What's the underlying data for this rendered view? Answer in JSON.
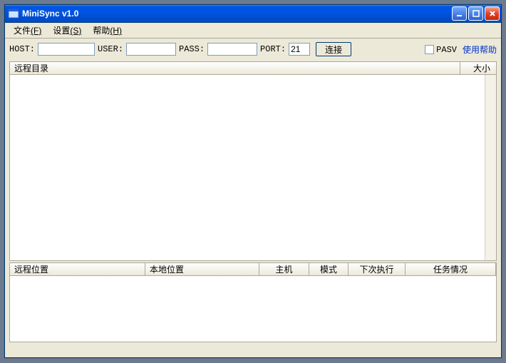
{
  "window": {
    "title": "MiniSync v1.0"
  },
  "menu": {
    "file": "文件",
    "file_accel": "(F)",
    "settings": "设置",
    "settings_accel": "(S)",
    "help": "帮助",
    "help_accel": "(H)"
  },
  "toolbar": {
    "host_label": "HOST:",
    "host_value": "",
    "user_label": "USER:",
    "user_value": "",
    "pass_label": "PASS:",
    "pass_value": "",
    "port_label": "PORT:",
    "port_value": "21",
    "connect_label": "连接",
    "pasv_label": "PASV",
    "pasv_checked": false,
    "help_link": "使用帮助"
  },
  "remote_panel": {
    "columns": {
      "name": "远程目录",
      "size": "大小"
    },
    "rows": []
  },
  "task_panel": {
    "columns": {
      "remote_loc": "远程位置",
      "local_loc": "本地位置",
      "host": "主机",
      "mode": "模式",
      "next_run": "下次执行",
      "status": "任务情况"
    },
    "rows": []
  },
  "win_buttons": {
    "minimize": "minimize-icon",
    "maximize": "maximize-icon",
    "close": "close-icon"
  }
}
